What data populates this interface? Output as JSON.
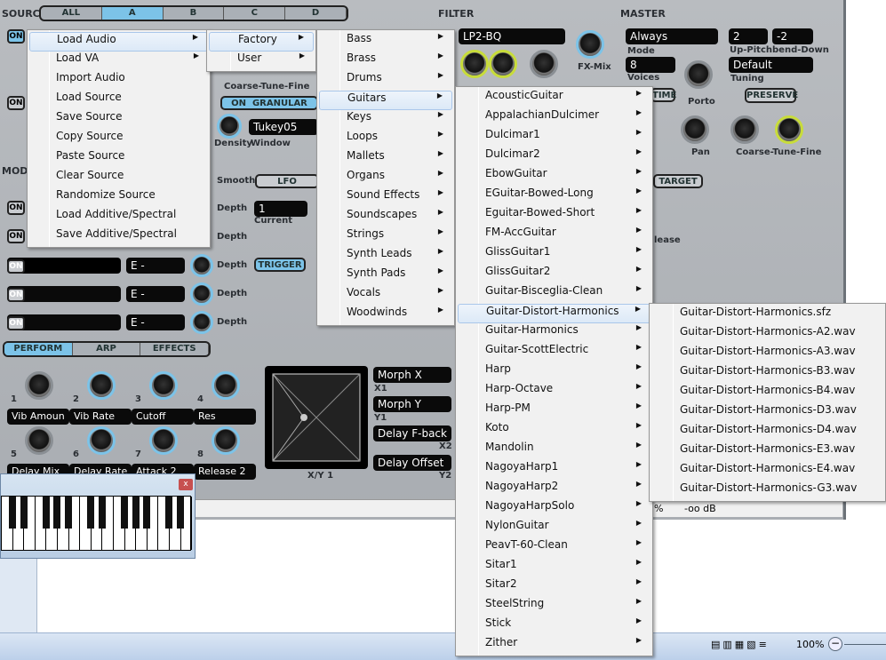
{
  "synth": {
    "source_label": "SOURCE",
    "source_tabs": [
      "ALL",
      "A",
      "B",
      "C",
      "D"
    ],
    "source_active": "A",
    "filter_label": "FILTER",
    "filter_type": "LP2-BQ",
    "fx_mix": "FX-Mix",
    "coarse_tune_fine": "Coarse-Tune-Fine",
    "granular": "GRANULAR",
    "on": "ON",
    "window_value": "Tukey05",
    "density": "Density",
    "window": "Window",
    "master_label": "MASTER",
    "mode_value": "Always",
    "mode": "Mode",
    "voices_value": "8",
    "voices": "Voices",
    "time": "TIME",
    "porto": "Porto",
    "pb_up": "2",
    "pb_down": "-2",
    "pitchbend": "Up-Pitchbend-Down",
    "tuning_value": "Default",
    "tuning": "Tuning",
    "preserve": "PRESERVE",
    "pan": "Pan",
    "master_ctf": "Coarse-Tune-Fine",
    "mod_label": "MODU",
    "smooth": "Smooth",
    "lfo": "LFO",
    "current_value": "1",
    "current": "Current",
    "trigger": "TRIGGER",
    "target": "TARGET",
    "release": "lease",
    "depth": "Depth",
    "e": "E",
    "dash": "-",
    "perform_tabs": [
      "PERFORM",
      "ARP",
      "EFFECTS"
    ],
    "knobs": [
      {
        "n": "1",
        "label": "Vib Amoun"
      },
      {
        "n": "2",
        "label": "Vib Rate"
      },
      {
        "n": "3",
        "label": "Cutoff"
      },
      {
        "n": "4",
        "label": "Res"
      },
      {
        "n": "5",
        "label": "Delay Mix"
      },
      {
        "n": "6",
        "label": "Delay Rate"
      },
      {
        "n": "7",
        "label": "Attack 2"
      },
      {
        "n": "8",
        "label": "Release 2"
      }
    ],
    "xy": {
      "name": "X/Y 1",
      "x1_value": "Morph X",
      "x1": "X1",
      "y1_value": "Morph Y",
      "y1": "Y1",
      "x2_value": "Delay F-back",
      "x2": "X2",
      "y2_value": "Delay Offset",
      "y2": "Y2"
    },
    "status_pct": "%",
    "status_db": "-oo dB"
  },
  "word": {
    "zoom": "100%"
  },
  "menus": {
    "source_menu": [
      "Load Audio",
      "Load VA",
      "Import Audio",
      "Load Source",
      "Save Source",
      "Copy Source",
      "Paste Source",
      "Clear Source",
      "Randomize Source",
      "Load Additive/Spectral",
      "Save Additive/Spectral"
    ],
    "load_audio_menu": [
      "Factory",
      "User"
    ],
    "factory_menu": [
      "Bass",
      "Brass",
      "Drums",
      "Guitars",
      "Keys",
      "Loops",
      "Mallets",
      "Organs",
      "Sound Effects",
      "Soundscapes",
      "Strings",
      "Synth Leads",
      "Synth Pads",
      "Vocals",
      "Woodwinds"
    ],
    "guitars_menu": [
      "AcousticGuitar",
      "AppalachianDulcimer",
      "Dulcimar1",
      "Dulcimar2",
      "EbowGuitar",
      "EGuitar-Bowed-Long",
      "Eguitar-Bowed-Short",
      "FM-AccGuitar",
      "GlissGuitar1",
      "GlissGuitar2",
      "Guitar-Bisceglia-Clean",
      "Guitar-Distort-Harmonics",
      "Guitar-Harmonics",
      "Guitar-ScottElectric",
      "Harp",
      "Harp-Octave",
      "Harp-PM",
      "Koto",
      "Mandolin",
      "NagoyaHarp1",
      "NagoyaHarp2",
      "NagoyaHarpSolo",
      "NylonGuitar",
      "PeavT-60-Clean",
      "Sitar1",
      "Sitar2",
      "SteelString",
      "Stick",
      "Zither"
    ],
    "files_menu": [
      "Guitar-Distort-Harmonics.sfz",
      "Guitar-Distort-Harmonics-A2.wav",
      "Guitar-Distort-Harmonics-A3.wav",
      "Guitar-Distort-Harmonics-B3.wav",
      "Guitar-Distort-Harmonics-B4.wav",
      "Guitar-Distort-Harmonics-D3.wav",
      "Guitar-Distort-Harmonics-D4.wav",
      "Guitar-Distort-Harmonics-E3.wav",
      "Guitar-Distort-Harmonics-E4.wav",
      "Guitar-Distort-Harmonics-G3.wav"
    ],
    "highlighted": {
      "source_menu": 0,
      "load_audio_menu": 0,
      "factory_menu": 3,
      "guitars_menu": 11
    }
  },
  "colors": {
    "accent": "#7cc3e8",
    "knob_ring": "#c8dc3a",
    "menu_bg": "#f1f1f1",
    "highlight": "#dce9f7"
  }
}
